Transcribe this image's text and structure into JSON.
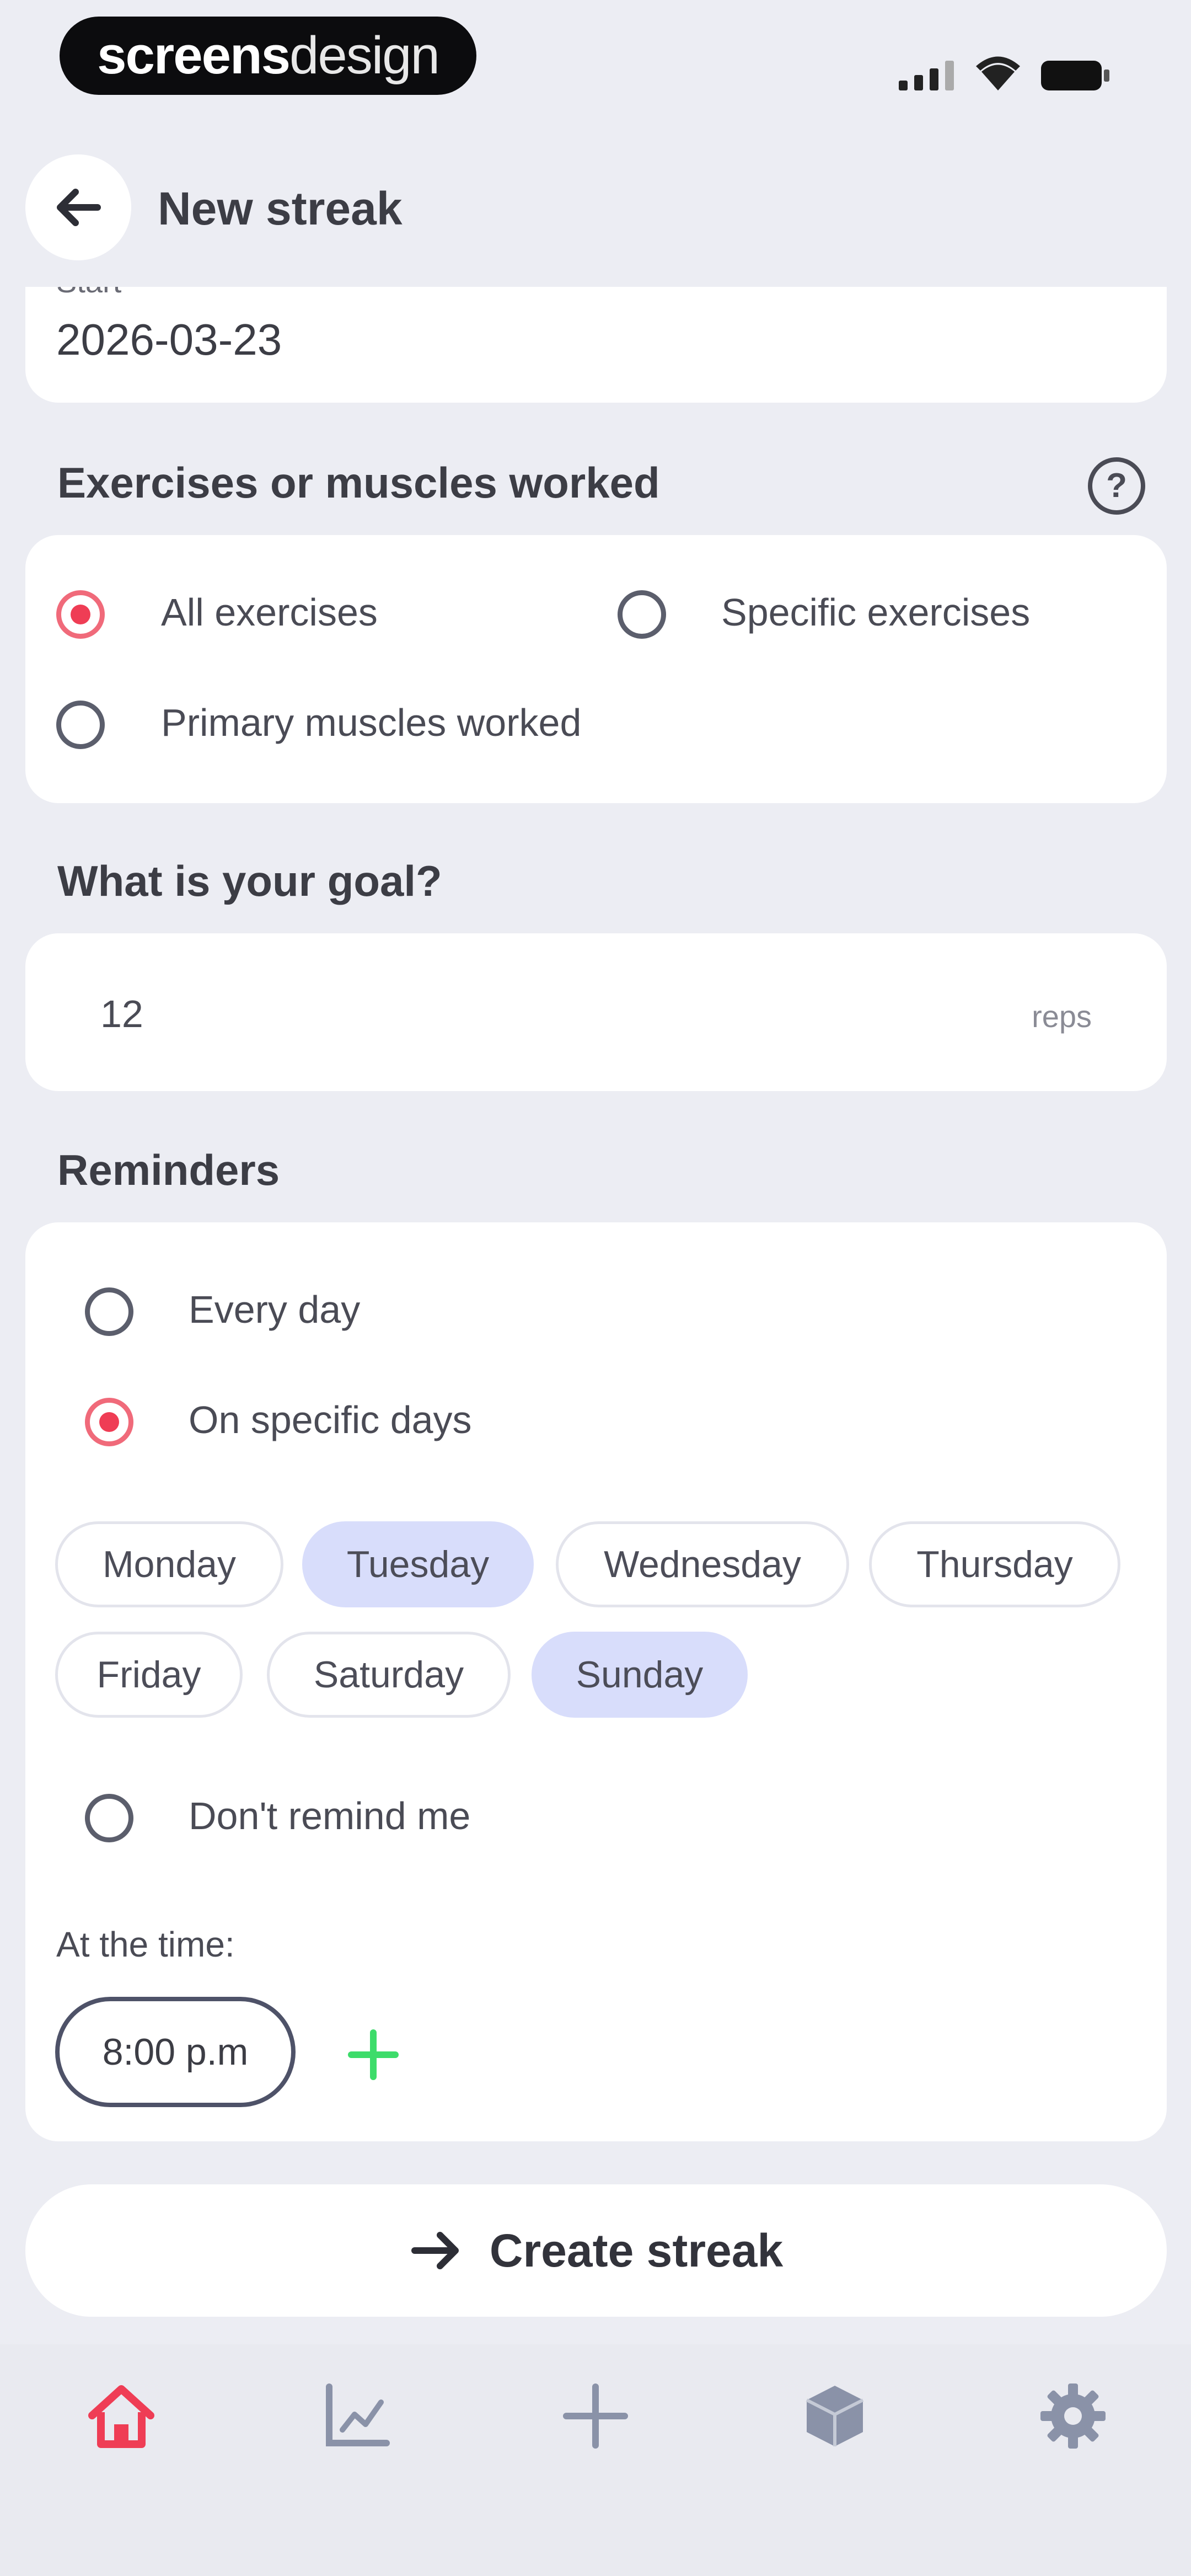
{
  "brand": {
    "part1": "screens",
    "part2": "design"
  },
  "header": {
    "title": "New streak"
  },
  "start": {
    "label": "Start",
    "value": "2026-03-23"
  },
  "exercises": {
    "title": "Exercises or muscles worked",
    "options": [
      {
        "label": "All exercises",
        "selected": true
      },
      {
        "label": "Specific exercises",
        "selected": false
      },
      {
        "label": "Primary muscles worked",
        "selected": false
      }
    ]
  },
  "goal": {
    "title": "What is your goal?",
    "value": "12",
    "unit": "reps"
  },
  "reminders": {
    "title": "Reminders",
    "options": [
      {
        "label": "Every day",
        "selected": false
      },
      {
        "label": "On specific days",
        "selected": true
      },
      {
        "label": "Don't remind me",
        "selected": false
      }
    ],
    "days": [
      {
        "label": "Monday",
        "selected": false
      },
      {
        "label": "Tuesday",
        "selected": true
      },
      {
        "label": "Wednesday",
        "selected": false
      },
      {
        "label": "Thursday",
        "selected": false
      },
      {
        "label": "Friday",
        "selected": false
      },
      {
        "label": "Saturday",
        "selected": false
      },
      {
        "label": "Sunday",
        "selected": true
      }
    ],
    "time_label": "At the time:",
    "time_value": "8:00 p.m"
  },
  "actions": {
    "create_label": "Create streak"
  },
  "tabs": [
    "home-icon",
    "chart-icon",
    "add-icon",
    "cube-icon",
    "settings-icon"
  ],
  "colors": {
    "accent": "#ef3d55",
    "chip_selected": "#d8ddfb",
    "add_green": "#3ddc6a",
    "background": "#ecedf3"
  }
}
